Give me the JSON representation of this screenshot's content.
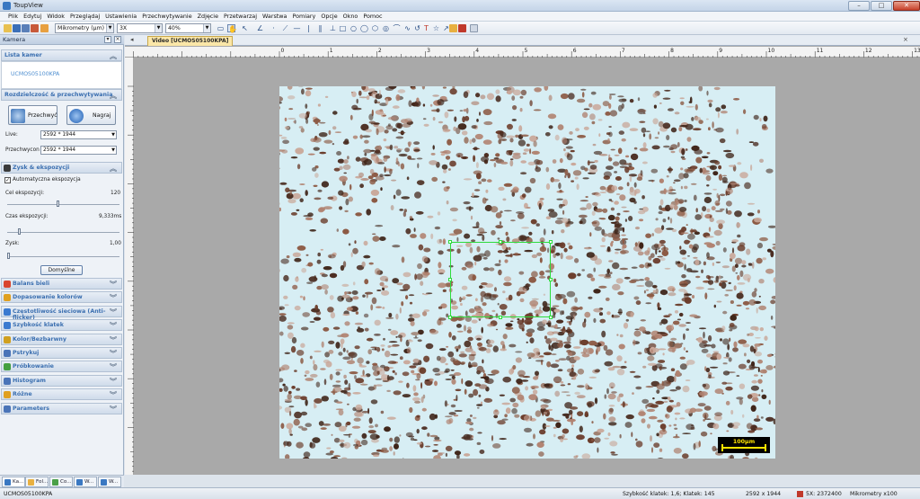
{
  "window": {
    "title": "ToupView"
  },
  "menu": [
    "Plik",
    "Edytuj",
    "Widok",
    "Przeglądaj",
    "Ustawienia",
    "Przechwytywanie",
    "Zdjęcie",
    "Przetwarzaj",
    "Warstwa",
    "Pomiary",
    "Opcje",
    "Okno",
    "Pomoc"
  ],
  "toolbar": {
    "unit": "Mikrometry (µm)",
    "magnification": "3X",
    "zoom": "40%"
  },
  "left_panel": {
    "title": "Kamera",
    "sections": {
      "camera_list": {
        "label": "Lista kamer",
        "camera": "UCMOS05100KPA"
      },
      "resolution": {
        "label": "Rozdzielczość & przechwytywania",
        "capture_button": "Przechwyć",
        "record_button": "Nagraj",
        "live_label": "Live:",
        "live_value": "2592 * 1944",
        "capture_label": "Przechwycon",
        "capture_value": "2592 * 1944"
      },
      "exposure": {
        "label": "Zysk & ekspozycji",
        "auto_label": "Automatyczna ekspozycja",
        "target_label": "Cel ekspozycji:",
        "target_value": "120",
        "target_level": 0.45,
        "time_label": "Czas ekspozycji:",
        "time_value": "9,333ms",
        "time_level": 0.1,
        "gain_label": "Zysk:",
        "gain_value": "1,00",
        "gain_level": 0.0,
        "default_button": "Domyślne"
      }
    },
    "collapsed_sections": [
      {
        "label": "Balans bieli",
        "color": "#d9452e"
      },
      {
        "label": "Dopasowanie kolorów",
        "color": "#e0a020"
      },
      {
        "label": "Częstotliwość sieciowa (Anti-flicker)",
        "color": "#3a7ad0"
      },
      {
        "label": "Szybkość klatek",
        "color": "#3a7ad0"
      },
      {
        "label": "Kolor/Bezbarwny",
        "color": "#d0a020"
      },
      {
        "label": "Pstrykuj",
        "color": "#4a74b8"
      },
      {
        "label": "Próbkowanie",
        "color": "#44a040"
      },
      {
        "label": "Histogram",
        "color": "#4a74b8"
      },
      {
        "label": "Różne",
        "color": "#e0a020"
      },
      {
        "label": "Parameters",
        "color": "#4a74b8"
      }
    ],
    "bottom_tabs": [
      "Ka...",
      "Fol...",
      "Co...",
      "W...",
      "W..."
    ]
  },
  "document": {
    "tab": "Video [UCMOS05100KPA]",
    "ruler_top": [
      "0",
      "1",
      "2",
      "3",
      "4",
      "5",
      "6",
      "7",
      "8",
      "9",
      "10",
      "11",
      "12",
      "13"
    ],
    "scale_label": "100µm"
  },
  "status": {
    "camera": "UCMOS05100KPA",
    "fps": "Szybkość klatek: 1,6; Klatek: 145",
    "resolution": "2592 x 1944",
    "coords": "5X: 2372400",
    "unit": "Mikrometry x100"
  }
}
